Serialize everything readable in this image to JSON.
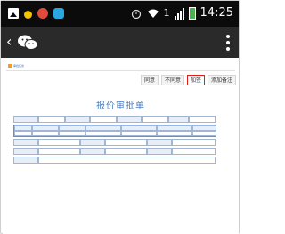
{
  "status_bar": {
    "time": "14:25",
    "wifi_label": "1",
    "icons": [
      "gallery-icon",
      "notification-dot-icon",
      "app-icon",
      "app-icon",
      "alarm-icon",
      "wifi-icon",
      "signal-icon",
      "battery-icon"
    ]
  },
  "action_bar": {
    "back_label": "‹",
    "app_icon": "wechat-icon",
    "menu_icon": "overflow-menu-icon"
  },
  "page": {
    "breadcrumb": "审批任务",
    "toolbar": [
      {
        "label": "同意",
        "highlighted": false
      },
      {
        "label": "不同意",
        "highlighted": false
      },
      {
        "label": "加签",
        "highlighted": true
      },
      {
        "label": "添加备注",
        "highlighted": false
      }
    ],
    "form_title": "报价审批单",
    "highlight_color": "#e21b1b",
    "title_color": "#4a7fc0"
  }
}
